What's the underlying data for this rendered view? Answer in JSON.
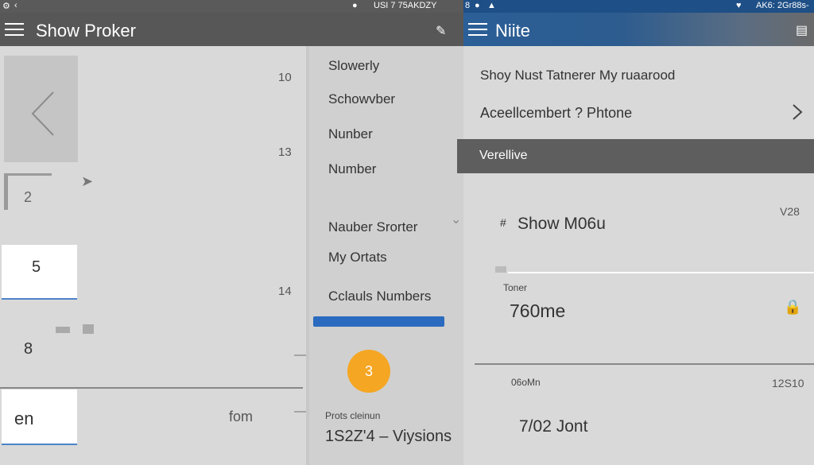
{
  "status_left": {
    "text": "USI 7 75AKDZY"
  },
  "status_right": {
    "text": "AK6: 2Gr88s-",
    "left_icons": "8"
  },
  "left_window": {
    "title": "Show Proker"
  },
  "right_window": {
    "title": "Niite"
  },
  "pane_a": {
    "num_10": "10",
    "num_13": "13",
    "num_14": "14",
    "tile_2": "2",
    "card_5": "5",
    "card_8": "8",
    "card_en": "en",
    "from_label": "fom"
  },
  "pane_b": {
    "items": [
      "Slowerly",
      "Schowvber",
      "Nunber",
      "Number",
      "Nauber  Srorter",
      "My Ortats",
      "Cclauls Numbers"
    ],
    "badge": "3",
    "footer_label": "Prots cleinun",
    "footer_value": "1S2Z'4 – Viysions"
  },
  "pane_c": {
    "row1": "Shoy Nust Tatnerer My ruaarood",
    "row2": "Aceellcembert ? Phtone",
    "selected_row": "Verellive",
    "section_value": "V28",
    "section_title": "Show M06u",
    "field_label": "Toner",
    "field_value": "760me",
    "sub_label": "06oMn",
    "sub_num": "12S10",
    "sub_value": "7/02 Jont"
  },
  "colors": {
    "accent_blue": "#2a6bc0",
    "badge_orange": "#f5a623",
    "toolbar_dark": "#575757",
    "toolbar_blue": "#2b5f97"
  }
}
